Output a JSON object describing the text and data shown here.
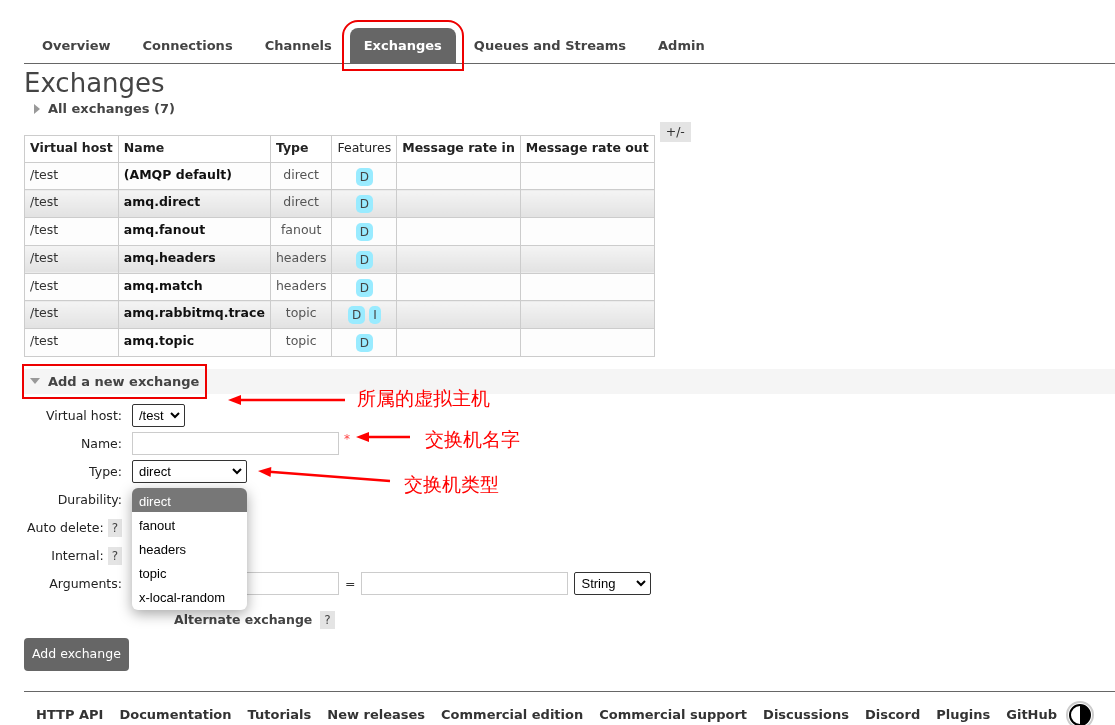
{
  "tabs": [
    {
      "label": "Overview",
      "selected": false,
      "highlighted": false
    },
    {
      "label": "Connections",
      "selected": false,
      "highlighted": false
    },
    {
      "label": "Channels",
      "selected": false,
      "highlighted": false
    },
    {
      "label": "Exchanges",
      "selected": true,
      "highlighted": true
    },
    {
      "label": "Queues and Streams",
      "selected": false,
      "highlighted": false
    },
    {
      "label": "Admin",
      "selected": false,
      "highlighted": false
    }
  ],
  "title": "Exchanges",
  "all_exchanges": {
    "label": "All exchanges (7)",
    "expanded": false
  },
  "table": {
    "columns": [
      "Virtual host",
      "Name",
      "Type",
      "Features",
      "Message rate in",
      "Message rate out"
    ],
    "toggle": "+/-",
    "rows": [
      {
        "vhost": "/test",
        "name": "(AMQP default)",
        "type": "direct",
        "features": [
          "D"
        ]
      },
      {
        "vhost": "/test",
        "name": "amq.direct",
        "type": "direct",
        "features": [
          "D"
        ]
      },
      {
        "vhost": "/test",
        "name": "amq.fanout",
        "type": "fanout",
        "features": [
          "D"
        ]
      },
      {
        "vhost": "/test",
        "name": "amq.headers",
        "type": "headers",
        "features": [
          "D"
        ]
      },
      {
        "vhost": "/test",
        "name": "amq.match",
        "type": "headers",
        "features": [
          "D"
        ]
      },
      {
        "vhost": "/test",
        "name": "amq.rabbitmq.trace",
        "type": "topic",
        "features": [
          "D",
          "I"
        ]
      },
      {
        "vhost": "/test",
        "name": "amq.topic",
        "type": "topic",
        "features": [
          "D"
        ]
      }
    ]
  },
  "add_section": {
    "label": "Add a new exchange",
    "expanded": true,
    "highlighted": true
  },
  "form": {
    "virtual_host": {
      "label": "Virtual host:",
      "value": "/test"
    },
    "name": {
      "label": "Name:",
      "required_mark": "*"
    },
    "type": {
      "label": "Type:",
      "value": "direct"
    },
    "durability": {
      "label": "Durability:"
    },
    "auto_delete": {
      "label": "Auto delete:",
      "help": "?"
    },
    "internal": {
      "label": "Internal:",
      "help": "?"
    },
    "arguments": {
      "label": "Arguments:",
      "equals": "=",
      "value_type": "String"
    },
    "alternate_exchange": {
      "label": "Alternate exchange",
      "help": "?"
    },
    "submit": "Add exchange"
  },
  "type_menu": {
    "options": [
      {
        "label": "direct",
        "selected": true
      },
      {
        "label": "fanout",
        "selected": false
      },
      {
        "label": "headers",
        "selected": false
      },
      {
        "label": "topic",
        "selected": false
      },
      {
        "label": "x-local-random",
        "selected": false
      }
    ]
  },
  "annotations": [
    {
      "text": "所属的虚拟主机"
    },
    {
      "text": "交换机名字"
    },
    {
      "text": "交换机类型"
    }
  ],
  "footer": {
    "links": [
      "HTTP API",
      "Documentation",
      "Tutorials",
      "New releases",
      "Commercial edition",
      "Commercial support",
      "Discussions",
      "Discord",
      "Plugins",
      "GitHub"
    ]
  }
}
